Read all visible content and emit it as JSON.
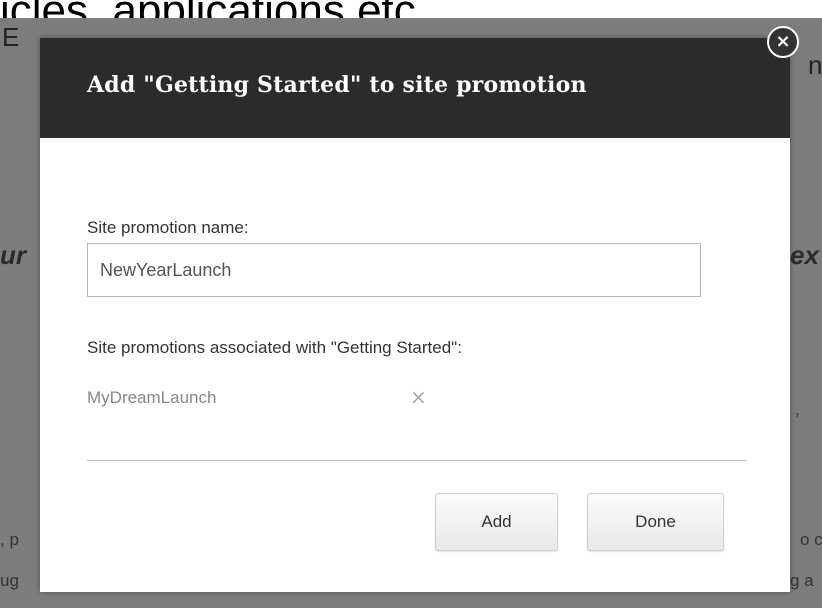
{
  "background": {
    "top_text": "icles, applications etc.",
    "fragments": {
      "e": "E",
      "nt": "n",
      "ur": "ur",
      "ex": "ex",
      "p": ", p",
      "ug": "ug",
      "cr": "o cr",
      "ga": "g a",
      "comma": ","
    }
  },
  "dialog": {
    "title": "Add \"Getting Started\" to site promotion",
    "close_icon": "close-icon",
    "name_label": "Site promotion name:",
    "name_value": "NewYearLaunch",
    "associated_label": "Site promotions associated with \"Getting Started\":",
    "associated_items": [
      {
        "name": "MyDreamLaunch",
        "remove_glyph": "×"
      }
    ],
    "add_label": "Add",
    "done_label": "Done",
    "close_glyph": "×"
  }
}
